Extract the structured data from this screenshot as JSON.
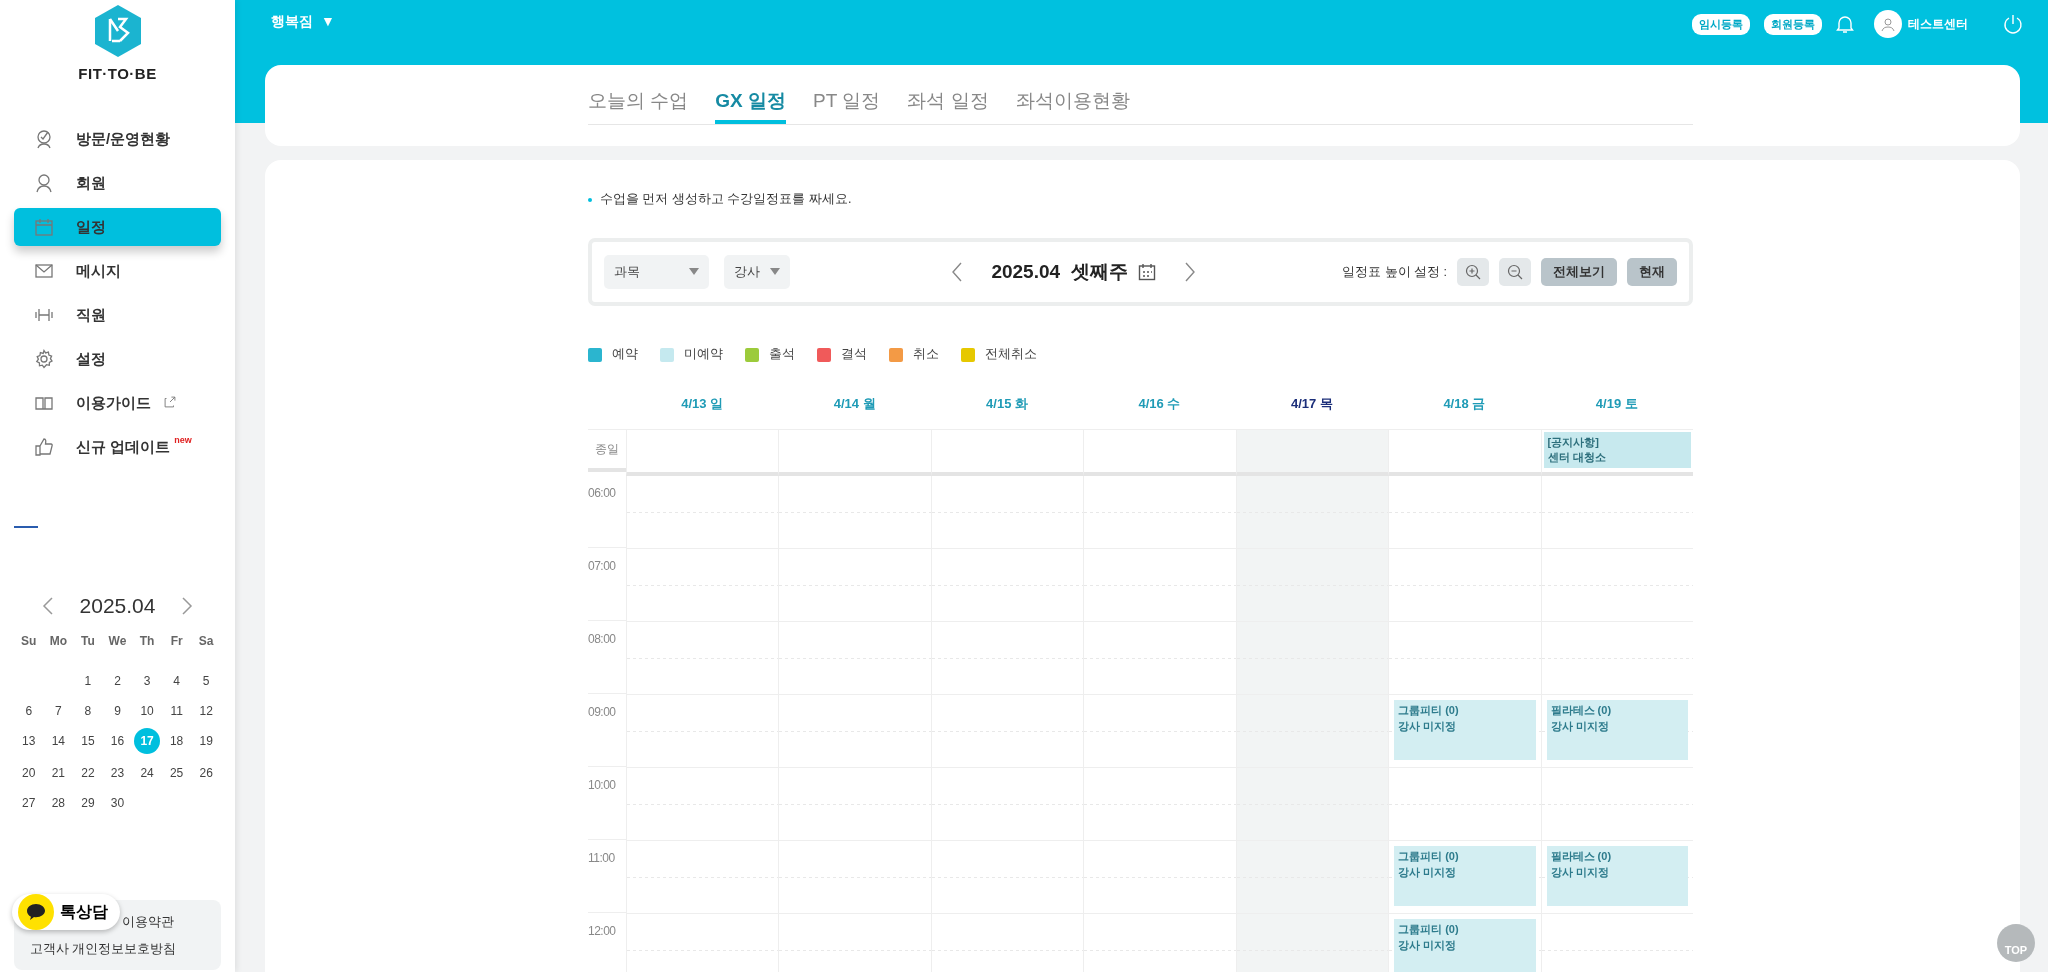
{
  "sidebar": {
    "logo_text": "FIT·TO·BE",
    "menu": [
      {
        "label": "방문/운영현황",
        "selected": false
      },
      {
        "label": "회원",
        "selected": false
      },
      {
        "label": "일정",
        "selected": true
      },
      {
        "label": "메시지",
        "selected": false
      },
      {
        "label": "직원",
        "selected": false
      },
      {
        "label": "설정",
        "selected": false
      },
      {
        "label": "이용가이드",
        "selected": false,
        "external": true
      },
      {
        "label": "신규 업데이트",
        "selected": false,
        "badge": "new"
      }
    ],
    "mini_calendar": {
      "month": "2025.04",
      "weekdays": [
        "Su",
        "Mo",
        "Tu",
        "We",
        "Th",
        "Fr",
        "Sa"
      ],
      "weeks": [
        [
          {
            "day": "1",
            "selected": false
          },
          {
            "day": "2",
            "selected": false
          },
          {
            "day": "3",
            "selected": false
          },
          {
            "day": "4",
            "selected": false
          },
          {
            "day": "5",
            "selected": false
          }
        ],
        [
          {
            "day": "6",
            "selected": false
          },
          {
            "day": "7",
            "selected": false
          },
          {
            "day": "8",
            "selected": false
          },
          {
            "day": "9",
            "selected": false
          },
          {
            "day": "10",
            "selected": false
          },
          {
            "day": "11",
            "selected": false
          },
          {
            "day": "12",
            "selected": false
          }
        ],
        [
          {
            "day": "13",
            "selected": false
          },
          {
            "day": "14",
            "selected": false
          },
          {
            "day": "15",
            "selected": false
          },
          {
            "day": "16",
            "selected": false
          },
          {
            "day": "17",
            "selected": true
          },
          {
            "day": "18",
            "selected": false
          },
          {
            "day": "19",
            "selected": false
          }
        ],
        [
          {
            "day": "20",
            "selected": false
          },
          {
            "day": "21",
            "selected": false
          },
          {
            "day": "22",
            "selected": false
          },
          {
            "day": "23",
            "selected": false
          },
          {
            "day": "24",
            "selected": false
          },
          {
            "day": "25",
            "selected": false
          },
          {
            "day": "26",
            "selected": false
          }
        ],
        [
          {
            "day": "27",
            "selected": false
          },
          {
            "day": "28",
            "selected": false
          },
          {
            "day": "29",
            "selected": false
          },
          {
            "day": "30",
            "selected": false
          }
        ]
      ]
    },
    "footer_links": [
      "이용약관",
      "고객사 개인정보보호방침"
    ],
    "chat_button": "톡상담"
  },
  "header": {
    "branch": "행복짐",
    "branch_caret": "▼",
    "buttons": [
      "임시등록",
      "회원등록"
    ],
    "user": "테스트센터"
  },
  "tabs": [
    {
      "label": "오늘의 수업",
      "selected": false
    },
    {
      "label": "GX 일정",
      "selected": true
    },
    {
      "label": "PT 일정",
      "selected": false
    },
    {
      "label": "좌석 일정",
      "selected": false
    },
    {
      "label": "좌석이용현황",
      "selected": false
    }
  ],
  "notice": "수업을 먼저 생성하고 수강일정표를 짜세요.",
  "toolbar": {
    "filters": [
      {
        "placeholder": "과목"
      },
      {
        "placeholder": "강사"
      }
    ],
    "week": "2025.04  셋째주",
    "height_label": "일정표 높이 설정 :",
    "buttons": [
      "전체보기",
      "현재"
    ]
  },
  "legend": [
    {
      "label": "예약",
      "color": "#2bb5cf"
    },
    {
      "label": "미예약",
      "color": "#c5e9ef"
    },
    {
      "label": "출석",
      "color": "#9ccb3b"
    },
    {
      "label": "결석",
      "color": "#f05a5a"
    },
    {
      "label": "취소",
      "color": "#f39a45"
    },
    {
      "label": "전체취소",
      "color": "#e6c800"
    }
  ],
  "schedule": {
    "allday_label": "종일",
    "hours": [
      "06:00",
      "07:00",
      "08:00",
      "09:00",
      "10:00",
      "11:00",
      "12:00"
    ],
    "days": [
      {
        "label": "4/13 일",
        "today": false
      },
      {
        "label": "4/14 월",
        "today": false
      },
      {
        "label": "4/15 화",
        "today": false
      },
      {
        "label": "4/16 수",
        "today": false
      },
      {
        "label": "4/17 목",
        "today": true
      },
      {
        "label": "4/18 금",
        "today": false,
        "blocks": [
          {
            "kind": "free"
          },
          {
            "kind": "free"
          },
          {
            "kind": "free"
          },
          {
            "kind": "class",
            "title": "그룹피티 (0)",
            "instructor": "강사 미지정"
          },
          {
            "kind": "free"
          },
          {
            "kind": "class",
            "title": "그룹피티 (0)",
            "instructor": "강사 미지정"
          },
          {
            "kind": "class",
            "title": "그룹피티 (0)",
            "instructor": "강사 미지정"
          }
        ]
      },
      {
        "label": "4/19 토",
        "today": false,
        "allday_event": {
          "category": "[공지사항]",
          "title": "센터 대청소"
        },
        "blocks": [
          {
            "kind": "free"
          },
          {
            "kind": "free"
          },
          {
            "kind": "free"
          },
          {
            "kind": "class",
            "title": "필라테스 (0)",
            "instructor": "강사 미지정"
          },
          {
            "kind": "free"
          },
          {
            "kind": "class",
            "title": "필라테스 (0)",
            "instructor": "강사 미지정"
          },
          {
            "kind": "free"
          }
        ]
      }
    ]
  },
  "top_button": "TOP"
}
